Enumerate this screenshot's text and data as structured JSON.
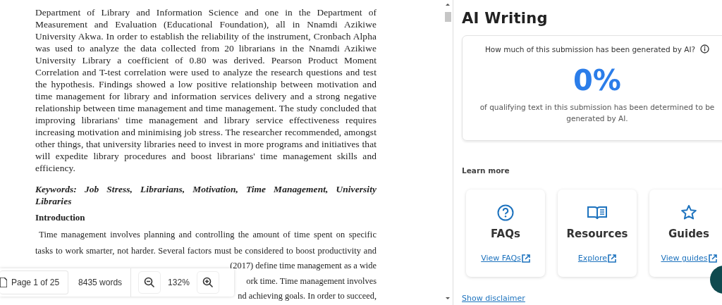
{
  "document": {
    "abstract": "Department of Library and Information Science and one in the Department of Measurement and Evaluation (Educational Foundation), all in Nnamdi Azikiwe University Akwa. In order to establish the reliability of the instrument, Cronbach Alpha was used to analyze the data collected from 20 librarians in the Nnamdi Azikiwe University Library a coefficient of 0.80 was derived. Pearson Product Moment Correlation and T-test correlation were used to analyze the research questions and test the hypothesis. Findings showed a low positive relationship between motivation and time management for library and information services delivery and a strong negative relationship between time management and time management. The study concluded that improving librarians' time management and library service effectiveness requires increasing motivation and minimising job stress. The researcher recommended, amongst other things, that university libraries need to invest in more programs and initiatives that will expedite library procedures and boost librarians' time management skills and efficiency.",
    "keywords": "Keywords: Job Stress, Librarians, Motivation, Time Management, University Libraries",
    "heading": "Introduction",
    "intro": "Time management involves planning and controlling the amount of time spent on specific tasks to work smarter, not harder. Several factors must be considered to boost productivity and",
    "partial_lines": [
      "(2017) define time management as a wide",
      "ork time. Time management involves",
      "nd achieving goals. In order to succeed,"
    ]
  },
  "toolbar": {
    "page": "Page 1 of 25",
    "words": "8435 words",
    "zoom": "132%"
  },
  "panel": {
    "title": "AI Writing",
    "question": "How much of this submission has been generated by AI?",
    "score": "0%",
    "caption": "of qualifying text in this submission has been determined to be generated by AI.",
    "learn_more": "Learn more",
    "resources": [
      {
        "kind": "faq",
        "title": "FAQs",
        "link": "View FAQs"
      },
      {
        "kind": "book",
        "title": "Resources",
        "link": "Explore"
      },
      {
        "kind": "star",
        "title": "Guides",
        "link": "View guides"
      }
    ],
    "disclaimer": "Show disclaimer"
  }
}
